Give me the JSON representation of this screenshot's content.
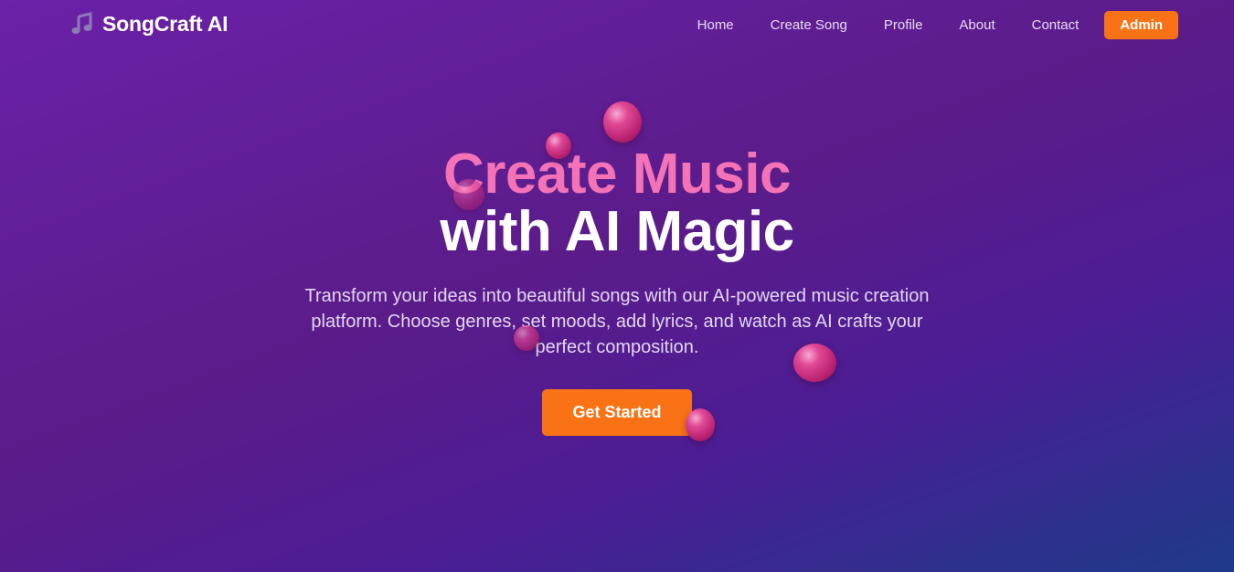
{
  "brand": {
    "name": "SongCraft AI",
    "icon": "music-note-icon"
  },
  "nav": {
    "items": [
      {
        "label": "Home"
      },
      {
        "label": "Create Song"
      },
      {
        "label": "Profile"
      },
      {
        "label": "About"
      },
      {
        "label": "Contact"
      }
    ],
    "admin_label": "Admin"
  },
  "hero": {
    "title_line1": "Create Music",
    "title_line2": "with AI Magic",
    "subtitle": "Transform your ideas into beautiful songs with our AI-powered music creation platform. Choose genres, set moods, add lyrics, and watch as AI crafts your perfect composition.",
    "cta_label": "Get Started"
  },
  "colors": {
    "accent": "#f97316",
    "title_pink": "#f472b6",
    "bg_start": "#6b21a8",
    "bg_end": "#1e3a8a",
    "ball": "#c0267a"
  }
}
